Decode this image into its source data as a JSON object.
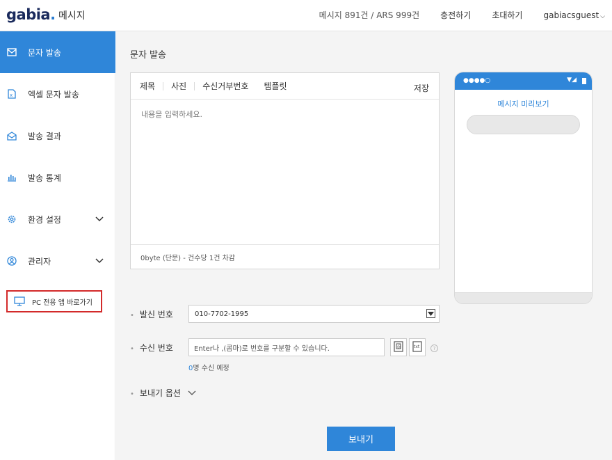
{
  "header": {
    "logo_text": "gabia",
    "logo_dot": ".",
    "logo_sub": "메시지",
    "quota": "메시지 891건 / ARS 999건",
    "charge": "충전하기",
    "invite": "초대하기",
    "user": "gabiacsguest"
  },
  "sidebar": {
    "items": [
      {
        "label": "문자 발송",
        "icon": "envelope-icon"
      },
      {
        "label": "엑셀 문자 발송",
        "icon": "excel-file-icon"
      },
      {
        "label": "발송 결과",
        "icon": "open-envelope-icon"
      },
      {
        "label": "발송 통계",
        "icon": "bar-chart-icon"
      },
      {
        "label": "환경 설정",
        "icon": "gear-icon"
      },
      {
        "label": "관리자",
        "icon": "user-circle-icon"
      }
    ],
    "pc_app": "PC 전용 앱 바로가기"
  },
  "main": {
    "title": "문자 발송",
    "toolbar": {
      "subject": "제목",
      "photo": "사진",
      "reject": "수신거부번호",
      "template": "템플릿",
      "save": "저장"
    },
    "editor_placeholder": "내용을 입력하세요.",
    "editor_footer": "0byte (단문) - 건수당 1건 차감",
    "preview_title": "메시지 미리보기",
    "sender_label": "발신 번호",
    "sender_value": "010-7702-1995",
    "receiver_label": "수신 번호",
    "receiver_placeholder": "Enter나 ,(콤마)로 번호를 구분할 수 있습니다.",
    "receiver_count_num": "0",
    "receiver_count_text": "명 수신 예정",
    "options_label": "보내기 옵션",
    "send_button": "보내기"
  },
  "colors": {
    "accent": "#2f86d9",
    "highlight_border": "#d32a2a"
  }
}
